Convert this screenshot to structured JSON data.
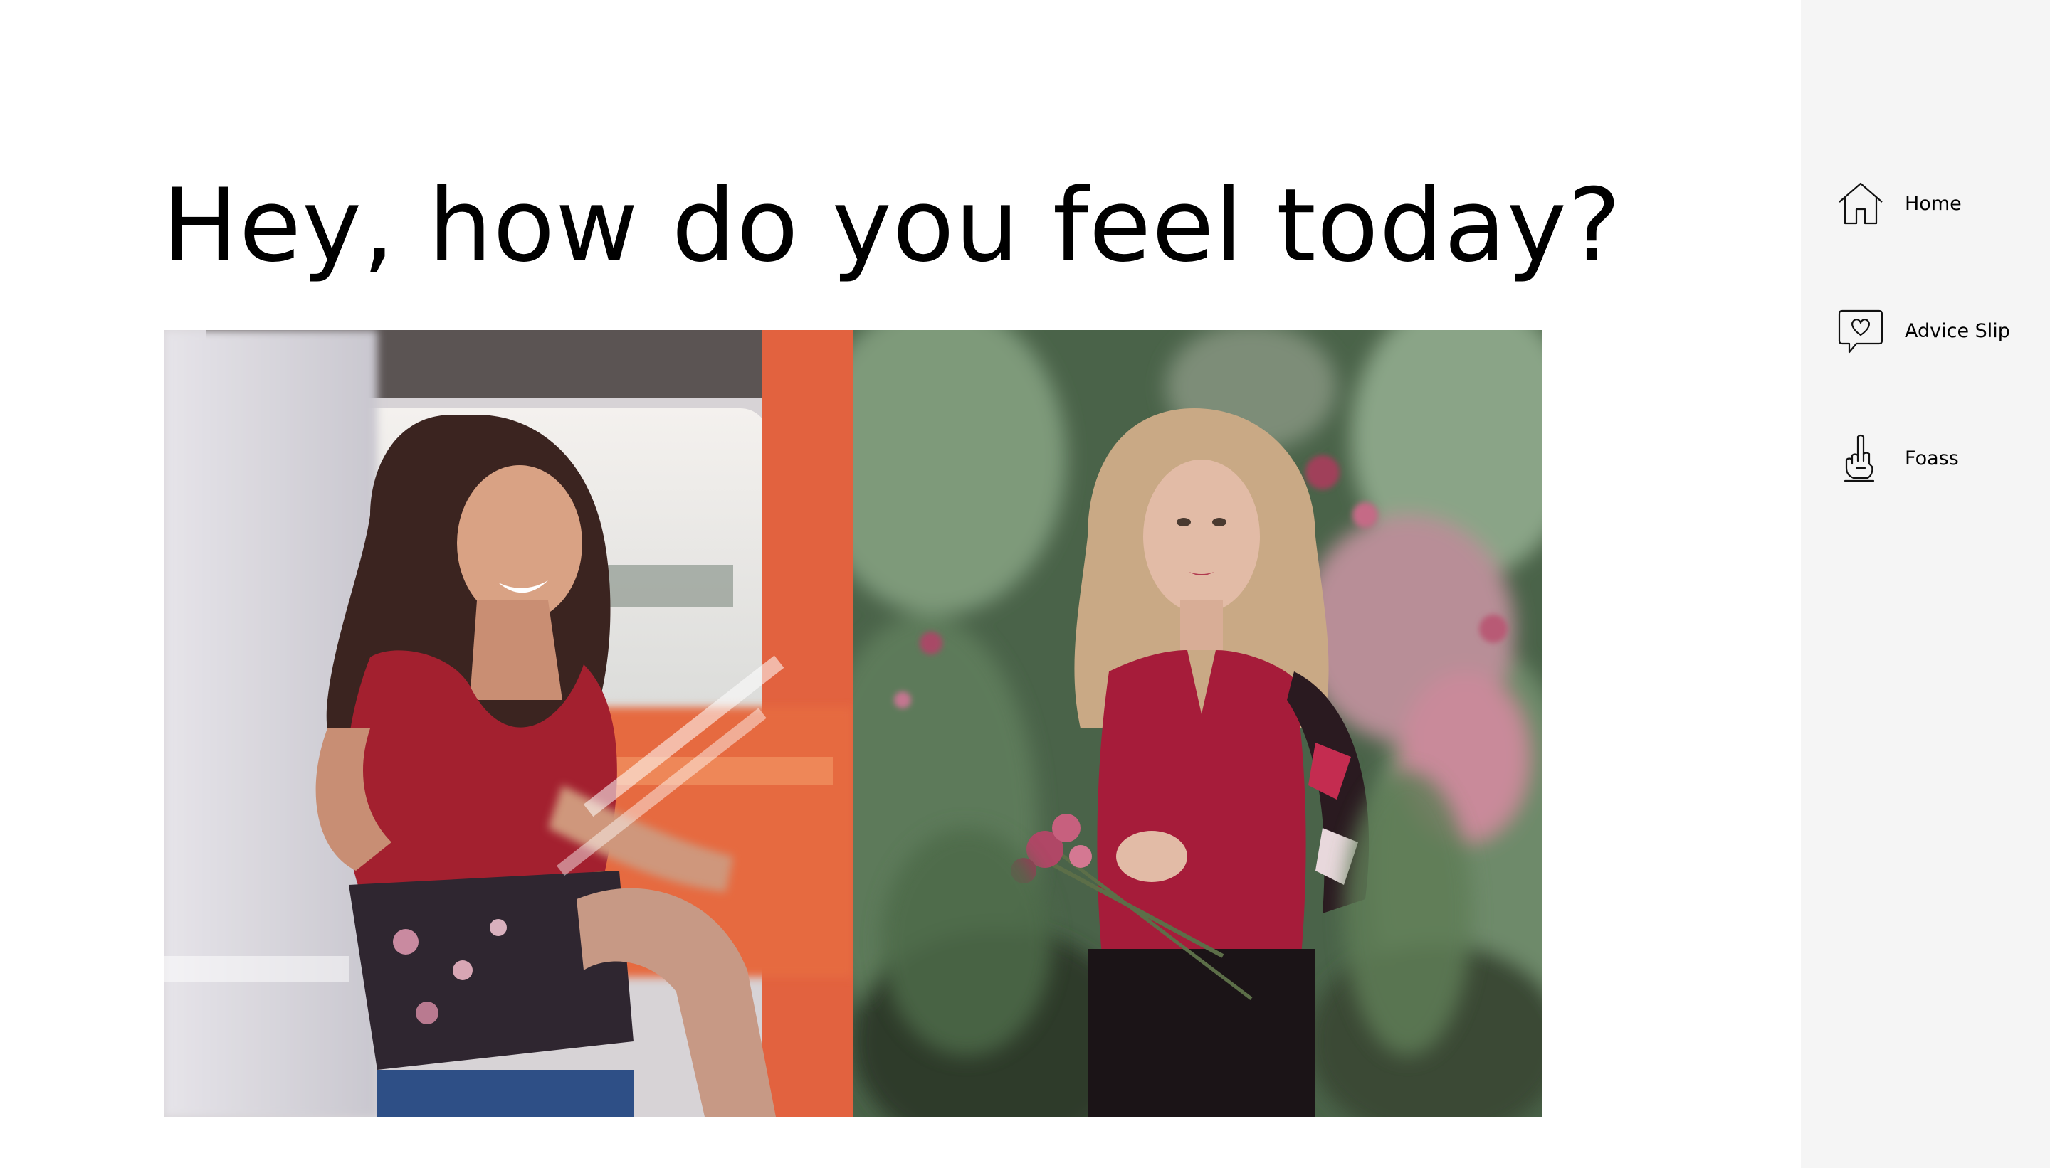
{
  "main": {
    "title": "Hey, how do you feel today?",
    "photos": [
      {
        "name": "photo-woman-in-vehicle",
        "subject": "smiling woman in red top sitting in an orange vehicle"
      },
      {
        "name": "photo-woman-with-flowers",
        "subject": "blonde woman in red top holding flowers among plants"
      }
    ]
  },
  "sidebar": {
    "items": [
      {
        "label": "Home",
        "icon": "home-icon"
      },
      {
        "label": "Advice Slip",
        "icon": "heart-speech-bubble-icon"
      },
      {
        "label": "Foass",
        "icon": "middle-finger-hand-icon"
      }
    ]
  },
  "colors": {
    "background": "#ffffff",
    "sidebar_background": "#f5f5f5",
    "text": "#000000"
  }
}
